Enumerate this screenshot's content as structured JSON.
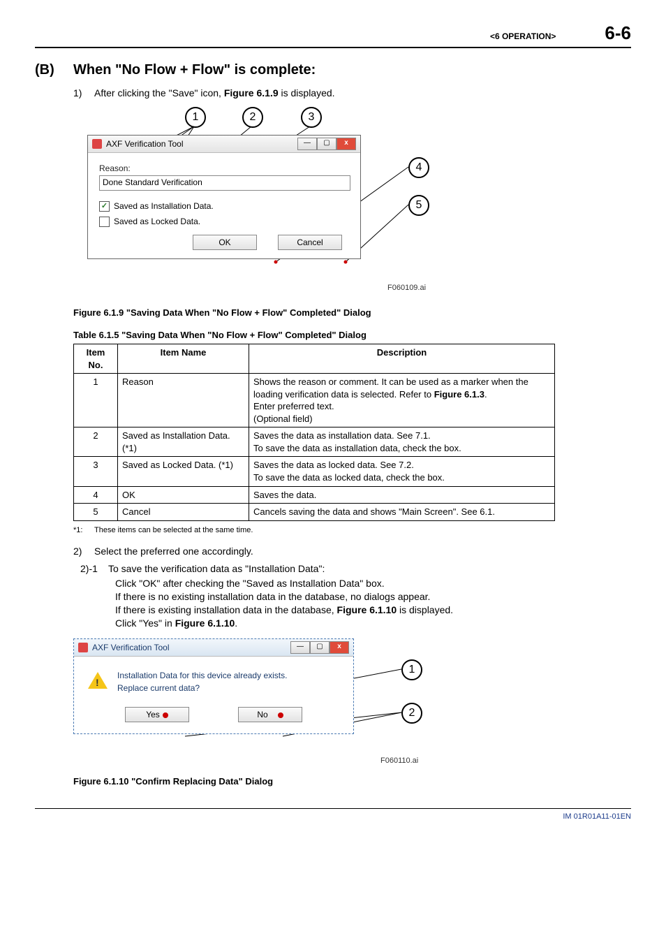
{
  "header": {
    "section": "<6  OPERATION>",
    "page": "6-6"
  },
  "sectionB": {
    "label": "(B)",
    "title": "When \"No Flow + Flow\" is complete:"
  },
  "step1": {
    "num": "1)",
    "text_before": "After clicking the \"Save\" icon, ",
    "fig_ref": "Figure 6.1.9",
    "text_after": " is displayed."
  },
  "dialog1": {
    "title": "AXF Verification Tool",
    "reason_label": "Reason:",
    "reason_value": "Done Standard Verification",
    "chk_install": "Saved as Installation Data.",
    "chk_install_checked": "✓",
    "chk_locked": "Saved as Locked Data.",
    "ok": "OK",
    "cancel": "Cancel",
    "close_glyph": "x",
    "ai": "F060109.ai",
    "callouts": {
      "c1": "1",
      "c2": "2",
      "c3": "3",
      "c4": "4",
      "c5": "5"
    }
  },
  "fig1_caption": "Figure 6.1.9 \"Saving Data When \"No Flow + Flow\" Completed\" Dialog",
  "table_title": "Table 6.1.5 \"Saving Data When \"No Flow + Flow\" Completed\" Dialog",
  "table": {
    "h_item_no": "Item No.",
    "h_item_name": "Item Name",
    "h_desc": "Description",
    "rows": [
      {
        "no": "1",
        "name": "Reason",
        "desc_pre": "Shows the reason or comment. It can be used as a marker when the loading verification data is selected. Refer to ",
        "desc_bold": "Figure 6.1.3",
        "desc_post": ".\nEnter preferred text.\n(Optional field)"
      },
      {
        "no": "2",
        "name": "Saved as Installation Data. (*1)",
        "desc": "Saves the data as installation data. See 7.1.\nTo save the data as installation data, check the box."
      },
      {
        "no": "3",
        "name": "Saved as Locked Data. (*1)",
        "desc": "Saves the data as locked data. See 7.2.\nTo save the data as locked data, check the box."
      },
      {
        "no": "4",
        "name": "OK",
        "desc": "Saves the data."
      },
      {
        "no": "5",
        "name": "Cancel",
        "desc": "Cancels saving the data and shows \"Main Screen\". See 6.1."
      }
    ]
  },
  "footnote": {
    "mark": "*1:",
    "text": "These items can be selected at the same time."
  },
  "step2": {
    "num": "2)",
    "text": "Select the preferred one accordingly."
  },
  "step2_1": {
    "num": "2)-1",
    "title": "To save the verification data as \"Installation Data\":",
    "l1": "Click \"OK\" after checking the \"Saved as Installation Data\" box.",
    "l2": "If there is no existing installation data in the database, no dialogs appear.",
    "l3_pre": "If there is existing installation data in the database, ",
    "l3_bold": "Figure 6.1.10",
    "l3_post": " is displayed.",
    "l4_pre": "Click \"Yes\" in ",
    "l4_bold": "Figure 6.1.10",
    "l4_post": "."
  },
  "dialog2": {
    "title": "AXF Verification Tool",
    "msg_l1": "Installation Data for this device already exists.",
    "msg_l2": "Replace current data?",
    "yes": "Yes",
    "no": "No",
    "close_glyph": "x",
    "ai": "F060110.ai",
    "callouts": {
      "c1": "1",
      "c2": "2"
    }
  },
  "fig2_caption": "Figure 6.1.10 \"Confirm Replacing Data\" Dialog",
  "footer": "IM 01R01A11-01EN"
}
